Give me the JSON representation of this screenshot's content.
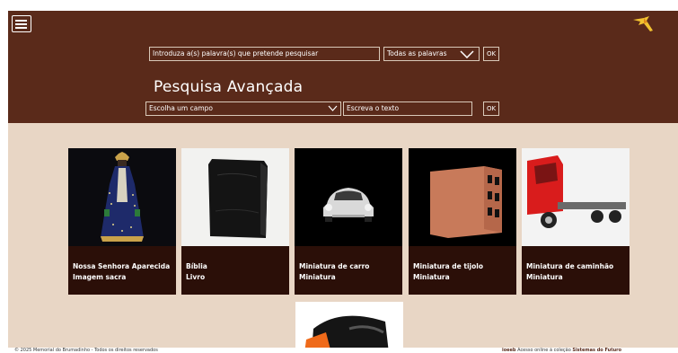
{
  "colors": {
    "header": "#5a2a1a",
    "body_bg": "#e8d6c5",
    "card": "#2b0f08",
    "logo": "#f2c230"
  },
  "icons": {
    "menu": "hamburger-menu-icon",
    "logo": "bird-logo-icon",
    "chevron": "chevron-down-icon"
  },
  "search": {
    "keywords_placeholder": "Introduza a(s) palavra(s) que pretende pesquisar",
    "mode_selected": "Todas as palavras",
    "ok_label": "OK"
  },
  "advanced": {
    "title": "Pesquisa Avançada",
    "field_selected": "Escolha um campo",
    "text_placeholder": "Escreva o texto",
    "ok_label": "OK"
  },
  "items": [
    {
      "title": "Nossa Senhora Aparecida",
      "type": "Imagem sacra"
    },
    {
      "title": "Bíblia",
      "type": "Livro"
    },
    {
      "title": "Miniatura de carro",
      "type": "Miniatura"
    },
    {
      "title": "Miniatura de tijolo",
      "type": "Miniatura"
    },
    {
      "title": "Miniatura de caminhão",
      "type": "Miniatura"
    }
  ],
  "footer": {
    "left": "© 2025 Memorial do Brumadinho - Todos os direitos reservados",
    "right_brand": "ioeeb",
    "right_text": " Acesso online à coleção ",
    "right_link": "Sistemas do Futuro"
  }
}
